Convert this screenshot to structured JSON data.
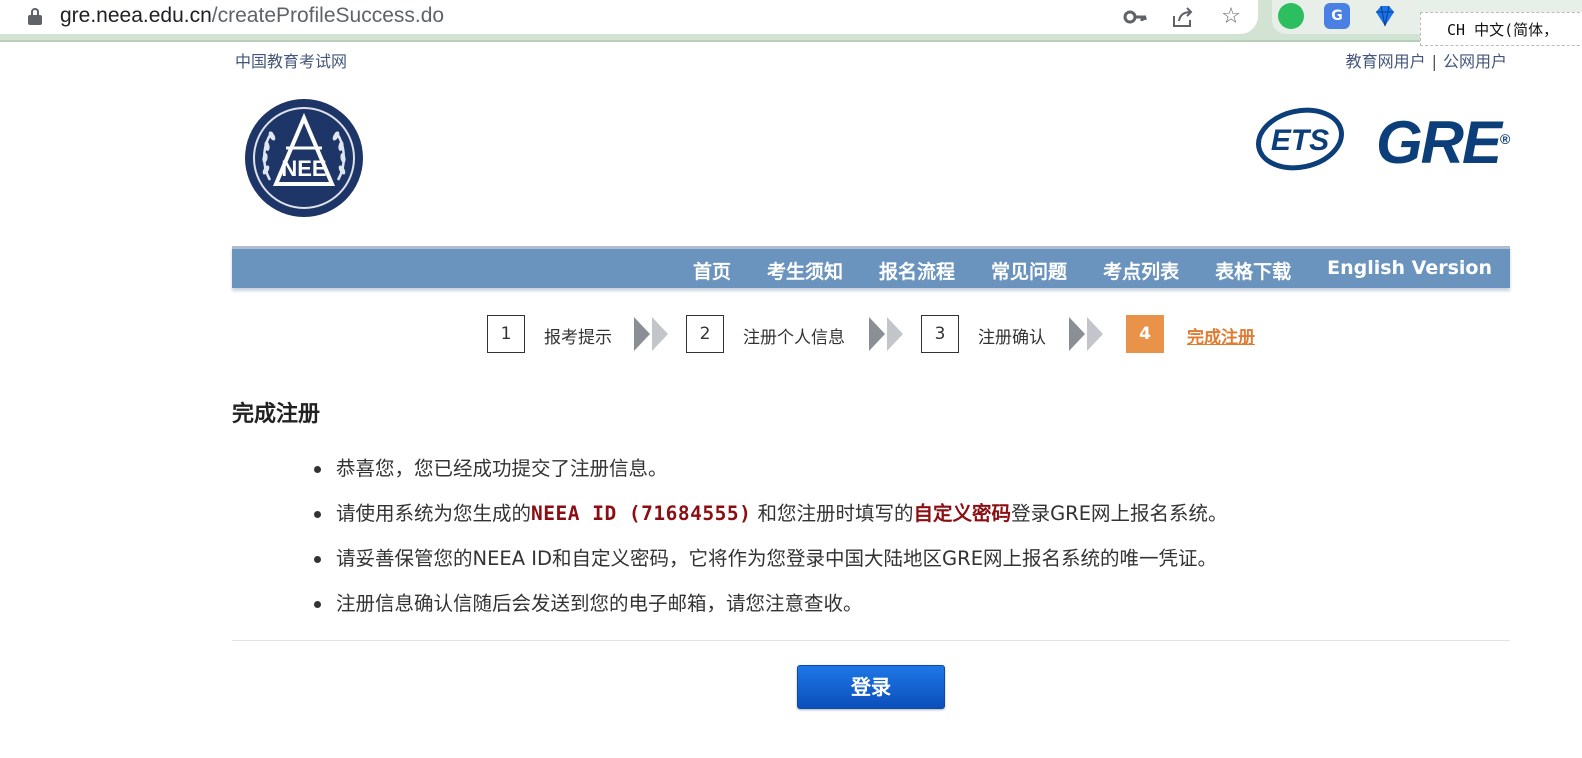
{
  "browser": {
    "url_host": "gre.neea.edu.cn",
    "url_path": "/createProfileSuccess.do",
    "ime_label": "CH 中文(简体，"
  },
  "header": {
    "site_link": "中国教育考试网",
    "user_links": [
      "教育网用户",
      "公网用户"
    ],
    "separator": "|",
    "neea_logo_text": "NEE",
    "ets_logo_text": "ETS",
    "gre_logo_text": "GRE",
    "brand_color": "#0c3f7a"
  },
  "nav": {
    "items": [
      "首页",
      "考生须知",
      "报名流程",
      "常见问题",
      "考点列表",
      "表格下载",
      "English Version"
    ],
    "bg_color": "#6a93bd"
  },
  "steps": [
    {
      "num": "1",
      "label": "报考提示",
      "active": false
    },
    {
      "num": "2",
      "label": "注册个人信息",
      "active": false
    },
    {
      "num": "3",
      "label": "注册确认",
      "active": false
    },
    {
      "num": "4",
      "label": "完成注册",
      "active": true
    }
  ],
  "main": {
    "title": "完成注册",
    "bullet1": "恭喜您，您已经成功提交了注册信息。",
    "bullet2": {
      "pre": "请使用系统为您生成的",
      "neea_id": "NEEA ID (71684555)",
      "mid": " 和您注册时填写的",
      "password": "自定义密码",
      "post": "登录GRE网上报名系统。"
    },
    "bullet3": "请妥善保管您的NEEA ID和自定义密码，它将作为您登录中国大陆地区GRE网上报名系统的唯一凭证。",
    "bullet4": "注册信息确认信随后会发送到您的电子邮箱，请您注意查收。",
    "highlight_color": "#8b0e12",
    "login_button": "登录"
  }
}
